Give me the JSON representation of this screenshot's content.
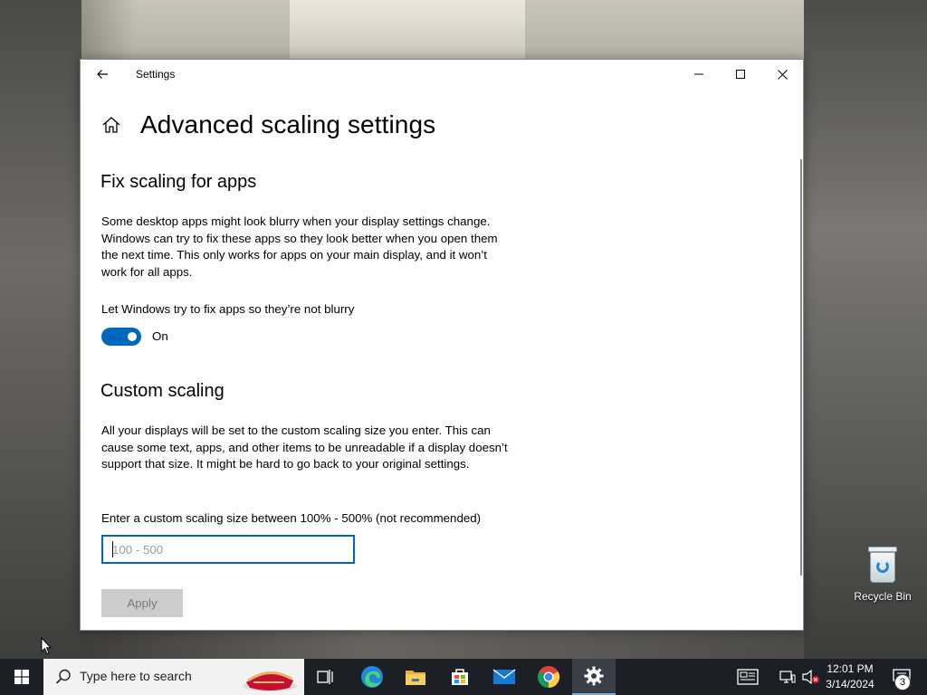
{
  "window": {
    "app_title": "Settings"
  },
  "page": {
    "title": "Advanced scaling settings"
  },
  "fix_scaling": {
    "heading": "Fix scaling for apps",
    "description": "Some desktop apps might look blurry when your display settings change. Windows can try to fix these apps so they look better when you open them the next time. This only works for apps on your main display, and it won’t work for all apps.",
    "toggle_label": "Let Windows try to fix apps so they’re not blurry",
    "toggle_state": "On",
    "toggle_on": true
  },
  "custom_scaling": {
    "heading": "Custom scaling",
    "description": "All your displays will be set to the custom scaling size you enter. This can cause some text, apps, and other items to be unreadable if a display doesn’t support that size. It might be hard to go back to your original settings.",
    "input_label": "Enter a custom scaling size between 100% - 500% (not recommended)",
    "input_placeholder": "100 - 500",
    "input_value": "",
    "apply_label": "Apply"
  },
  "desktop": {
    "recycle_bin_label": "Recycle Bin"
  },
  "taskbar": {
    "search_placeholder": "Type here to search",
    "time": "12:01 PM",
    "date": "3/14/2024",
    "notification_count": "3",
    "pinned": [
      "task-view",
      "edge",
      "file-explorer",
      "microsoft-store",
      "mail",
      "chrome",
      "settings"
    ]
  },
  "colors": {
    "accent": "#0067c0",
    "taskbar": "#1c1f26",
    "button_disabled": "#cccccc"
  }
}
